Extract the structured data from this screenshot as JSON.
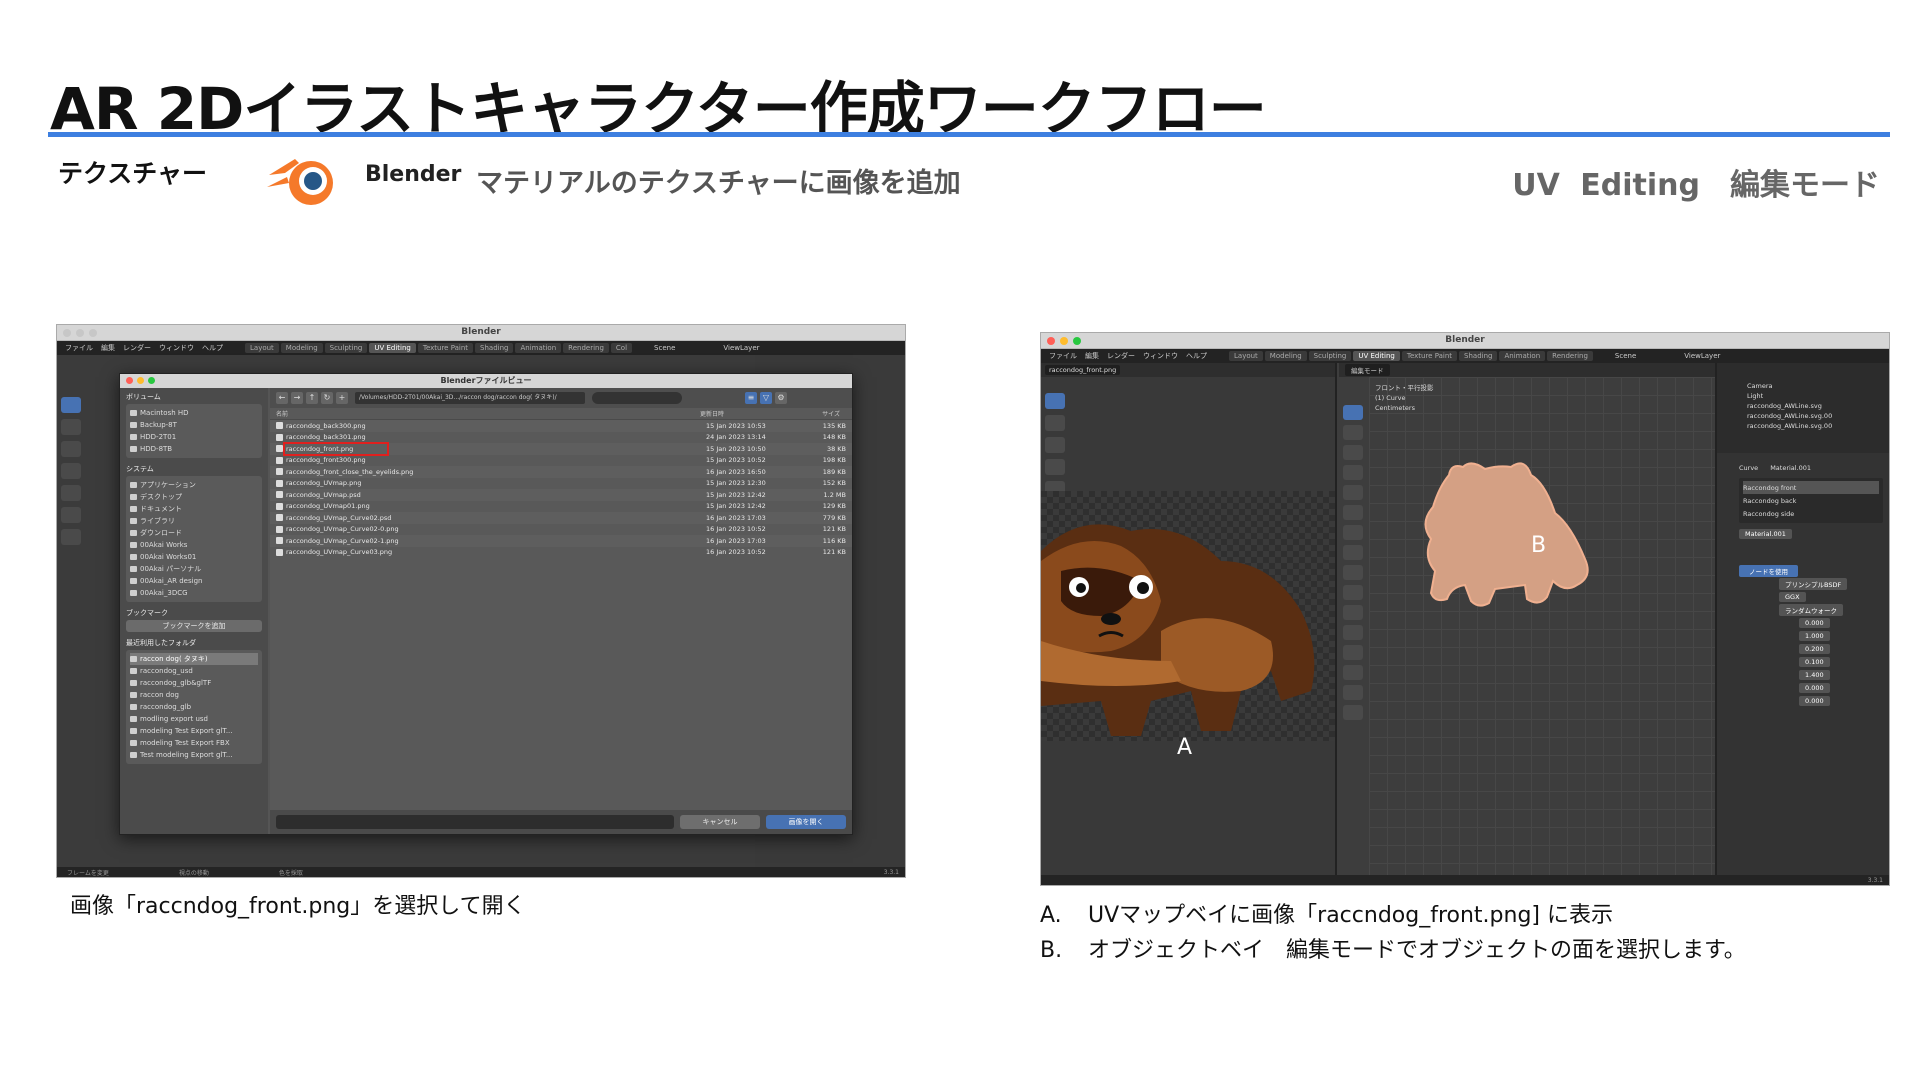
{
  "slide": {
    "title": "AR 2Dイラストキャラクター作成ワークフロー",
    "section": "テクスチャー",
    "app_name": "Blender",
    "description": "マテリアルのテクスチャーに画像を追加",
    "workspace_mode": "UV Editing　編集モード"
  },
  "colors": {
    "accent_rule": "#3d7fe0",
    "highlight_box": "#e0201e",
    "blender_orange": "#f5792a",
    "blender_blue": "#265787"
  },
  "left_screenshot": {
    "window_title": "Blender",
    "menu": [
      "ファイル",
      "編集",
      "レンダー",
      "ウィンドウ",
      "ヘルプ"
    ],
    "workspaces": [
      "Layout",
      "Modeling",
      "Sculpting",
      "UV Editing",
      "Texture Paint",
      "Shading",
      "Animation",
      "Rendering",
      "Col"
    ],
    "scene_label": "Scene",
    "view_layer_label": "ViewLayer",
    "dialog": {
      "title": "Blenderファイルビュー",
      "volumes_title": "ボリューム",
      "volumes": [
        "Macintosh HD",
        "Backup-8T",
        "HDD-2T01",
        "HDD-8TB"
      ],
      "system_title": "システム",
      "system": [
        "アプリケーション",
        "デスクトップ",
        "ドキュメント",
        "ライブラリ",
        "ダウンロード",
        "00Akai Works",
        "00Akai Works01",
        "00Akai パーソナル",
        "00Akai_AR design",
        "00Akai_3DCG"
      ],
      "bookmarks_title": "ブックマーク",
      "add_bookmark": "ブックマークを追加",
      "recent_title": "最近利用したフォルダ",
      "recent": [
        "raccon dog( タヌキ)",
        "raccondog_usd",
        "raccondog_glb&glTF",
        "raccon dog",
        "raccondog_glb",
        "modling export usd",
        "modeling Test Export glT...",
        "modeling Test Export FBX",
        "Test modeling Export glT..."
      ],
      "path": "/Volumes/HDD-2T01/00Akai_3D.../raccon dog/raccon dog( タヌキ)/",
      "col_name": "名前",
      "col_date": "更新日時",
      "col_size": "サイズ",
      "files": [
        {
          "name": "raccondog_back300.png",
          "date": "15 Jan 2023 10:53",
          "size": "135 KB"
        },
        {
          "name": "raccondog_back301.png",
          "date": "24 Jan 2023 13:14",
          "size": "148 KB"
        },
        {
          "name": "raccondog_front.png",
          "date": "15 Jan 2023 10:50",
          "size": "38 KB"
        },
        {
          "name": "raccondog_front300.png",
          "date": "15 Jan 2023 10:52",
          "size": "198 KB"
        },
        {
          "name": "raccondog_front_close_the_eyelids.png",
          "date": "16 Jan 2023 16:50",
          "size": "189 KB"
        },
        {
          "name": "raccondog_UVmap.png",
          "date": "15 Jan 2023 12:30",
          "size": "152 KB"
        },
        {
          "name": "raccondog_UVmap.psd",
          "date": "15 Jan 2023 12:42",
          "size": "1.2 MB"
        },
        {
          "name": "raccondog_UVmap01.png",
          "date": "15 Jan 2023 12:42",
          "size": "129 KB"
        },
        {
          "name": "raccondog_UVmap_Curve02.psd",
          "date": "16 Jan 2023 17:03",
          "size": "779 KB"
        },
        {
          "name": "raccondog_UVmap_Curve02-0.png",
          "date": "16 Jan 2023 10:52",
          "size": "121 KB"
        },
        {
          "name": "raccondog_UVmap_Curve02-1.png",
          "date": "16 Jan 2023 17:03",
          "size": "116 KB"
        },
        {
          "name": "raccondog_UVmap_Curve03.png",
          "date": "16 Jan 2023 10:52",
          "size": "121 KB"
        }
      ],
      "cancel": "キャンセル",
      "open": "画像を開く"
    },
    "status": [
      "フレームを変更",
      "視点の移動",
      "色を採取"
    ],
    "version": "3.3.1"
  },
  "right_screenshot": {
    "window_title": "Blender",
    "uv_image_name": "raccondog_front.png",
    "viewport_info": [
      "フロント・平行投影",
      "(1) Curve",
      "Centimeters"
    ],
    "edit_mode": "編集モード",
    "outliner": [
      "Camera",
      "Light",
      "raccondog_AWLine.svg",
      "raccondog_AWLine.svg.00",
      "raccondog_AWLine.svg.00"
    ],
    "props": {
      "object": "Curve",
      "material": "Material.001",
      "slots": [
        "Raccondog front",
        "Raccondog back",
        "Raccondog side"
      ],
      "use_nodes": "ノードを使用",
      "surface": "プリンシプルBSDF",
      "distribution": "GGX",
      "subsurface_method": "ランダムウォーク",
      "values": [
        "0.000",
        "1.000",
        "0.200",
        "0.100",
        "1.400",
        "0.000",
        "0.000"
      ]
    },
    "label_a": "A",
    "label_b": "B",
    "version": "3.3.1"
  },
  "captions": {
    "left": "画像「raccndog_front.png」を選択して開く",
    "right": [
      {
        "letter": "A.",
        "text": "UVマップベイに画像「raccndog_front.png] に表示"
      },
      {
        "letter": "B.",
        "text": "オブジェクトベイ　編集モードでオブジェクトの面を選択します。"
      }
    ]
  }
}
